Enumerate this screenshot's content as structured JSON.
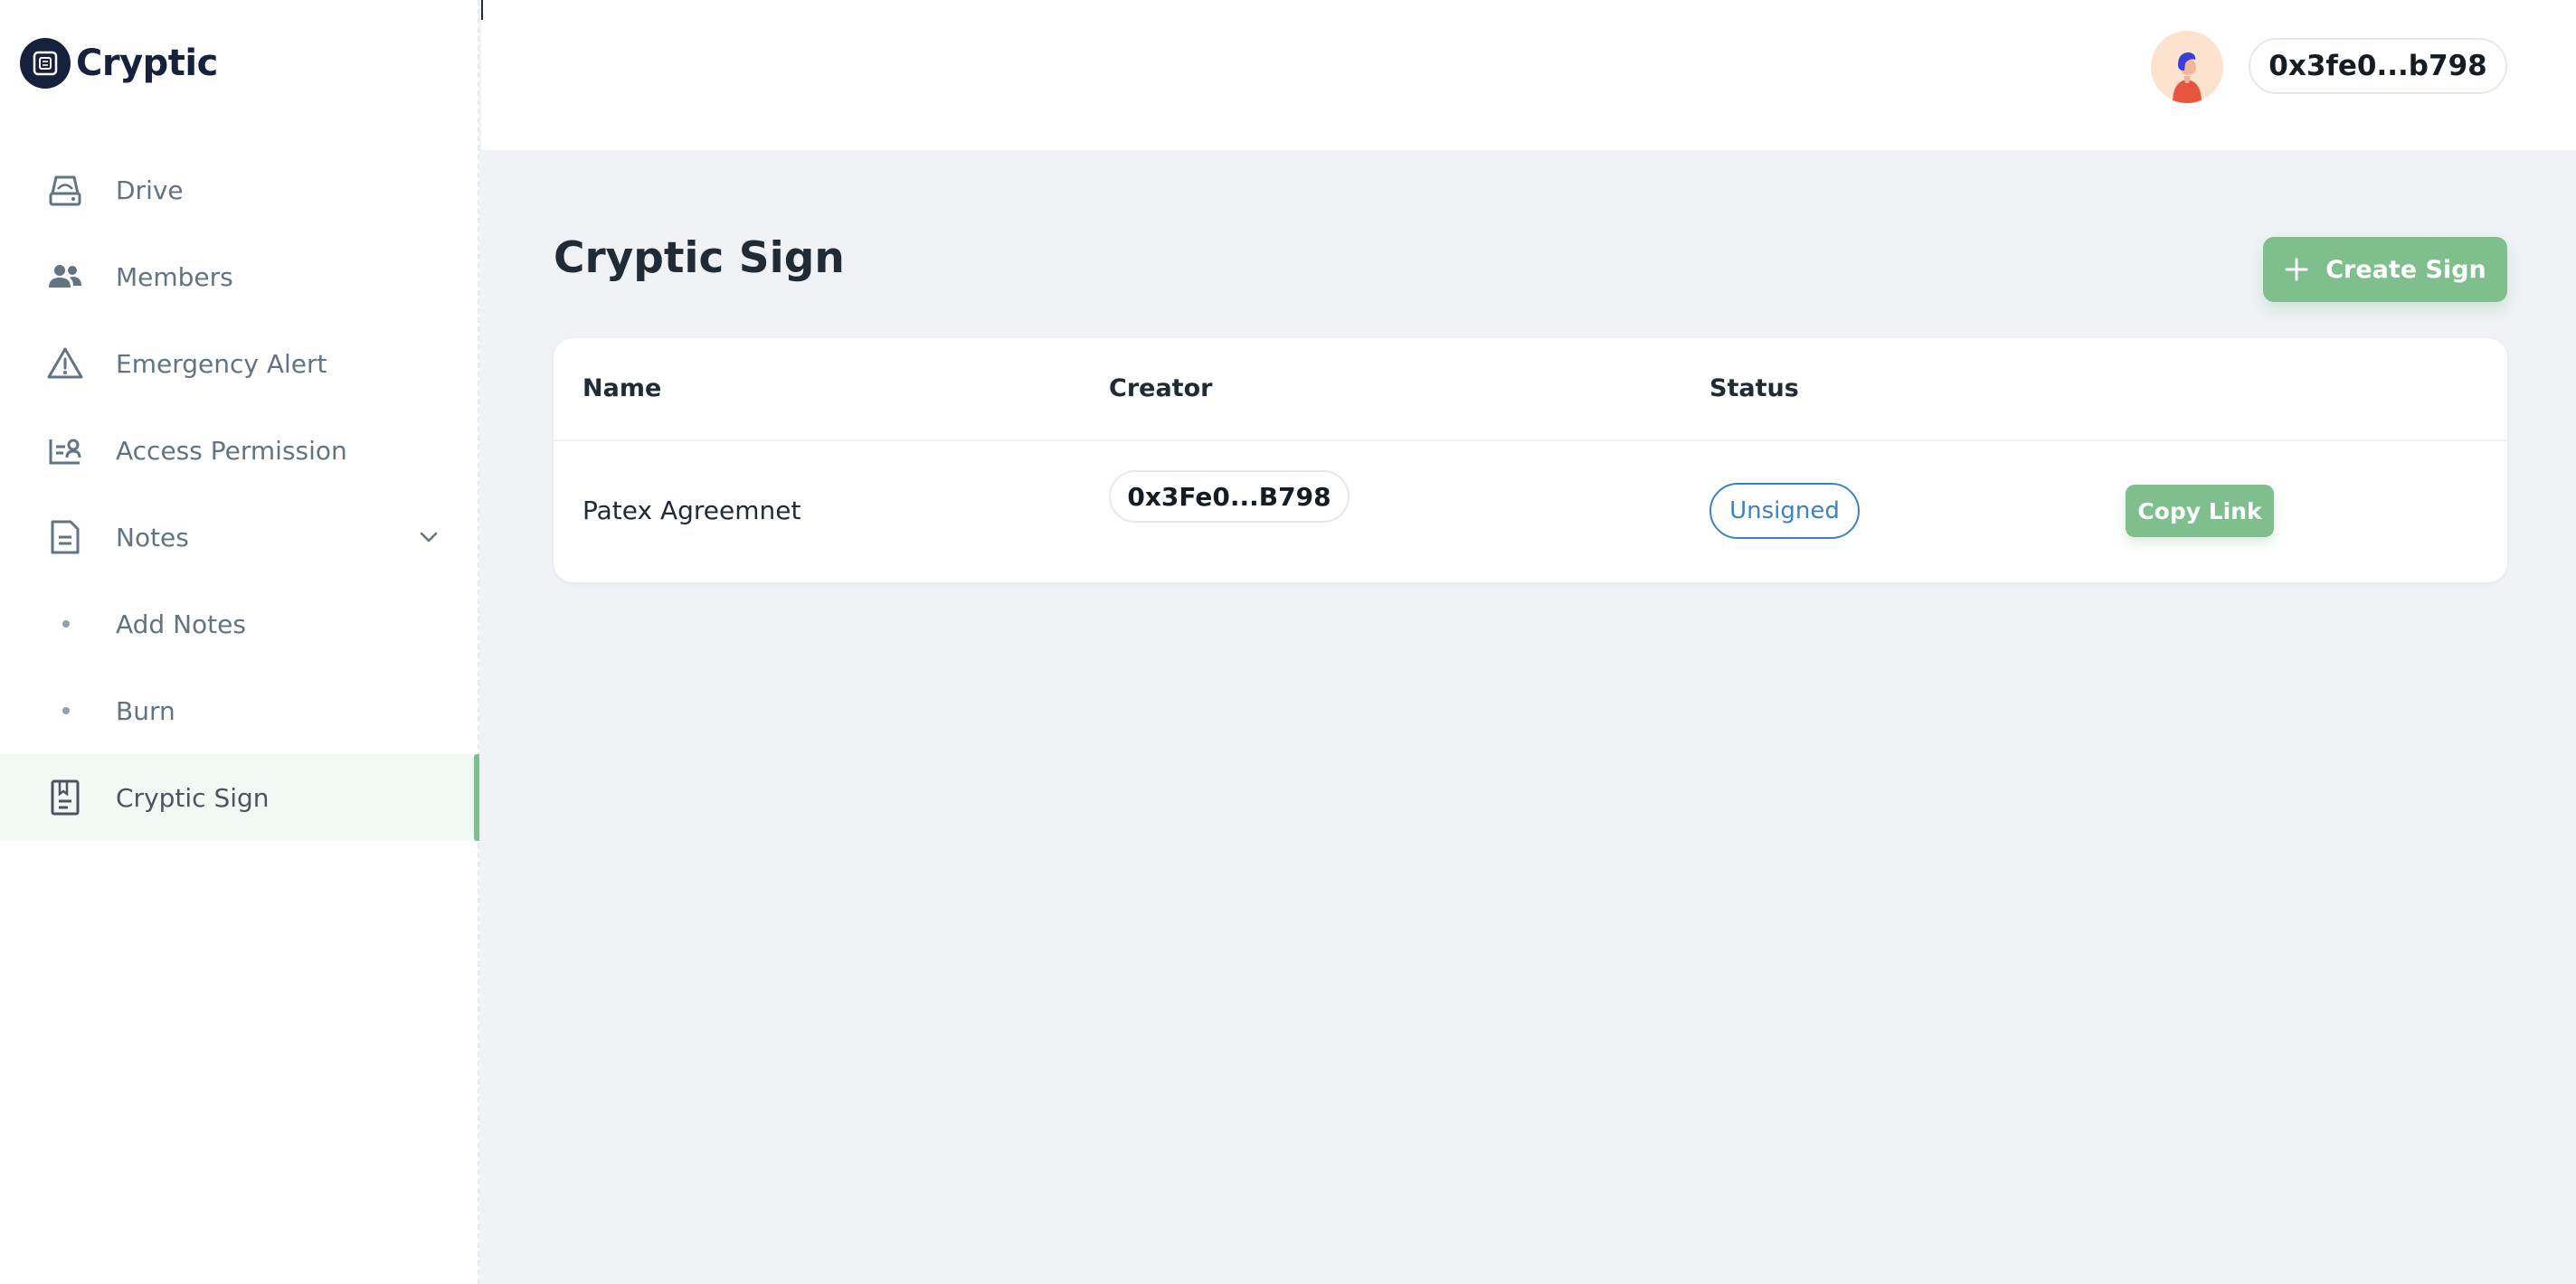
{
  "app": {
    "name": "Cryptic"
  },
  "sidebar": {
    "items": [
      {
        "label": "Drive",
        "icon": "drive-icon"
      },
      {
        "label": "Members",
        "icon": "members-icon"
      },
      {
        "label": "Emergency Alert",
        "icon": "alert-triangle-icon"
      },
      {
        "label": "Access Permission",
        "icon": "access-card-icon"
      },
      {
        "label": "Notes",
        "icon": "note-icon",
        "expanded": true,
        "children": [
          {
            "label": "Add Notes"
          },
          {
            "label": "Burn"
          }
        ]
      },
      {
        "label": "Cryptic Sign",
        "icon": "sign-document-icon",
        "active": true
      }
    ]
  },
  "header": {
    "wallet": "0x3fe0...b798",
    "avatar_icon": "user-avatar-icon"
  },
  "main": {
    "title": "Cryptic Sign",
    "create_button": "Create Sign",
    "table": {
      "columns": [
        "Name",
        "Creator",
        "Status"
      ],
      "rows": [
        {
          "name": "Patex Agreemnet",
          "creator": "0x3Fe0...B798",
          "status": "Unsigned",
          "action": "Copy Link"
        }
      ]
    }
  },
  "colors": {
    "accent": "#7fbf8e",
    "status_unsigned": "#3b82c4",
    "logo": "#16213d"
  }
}
